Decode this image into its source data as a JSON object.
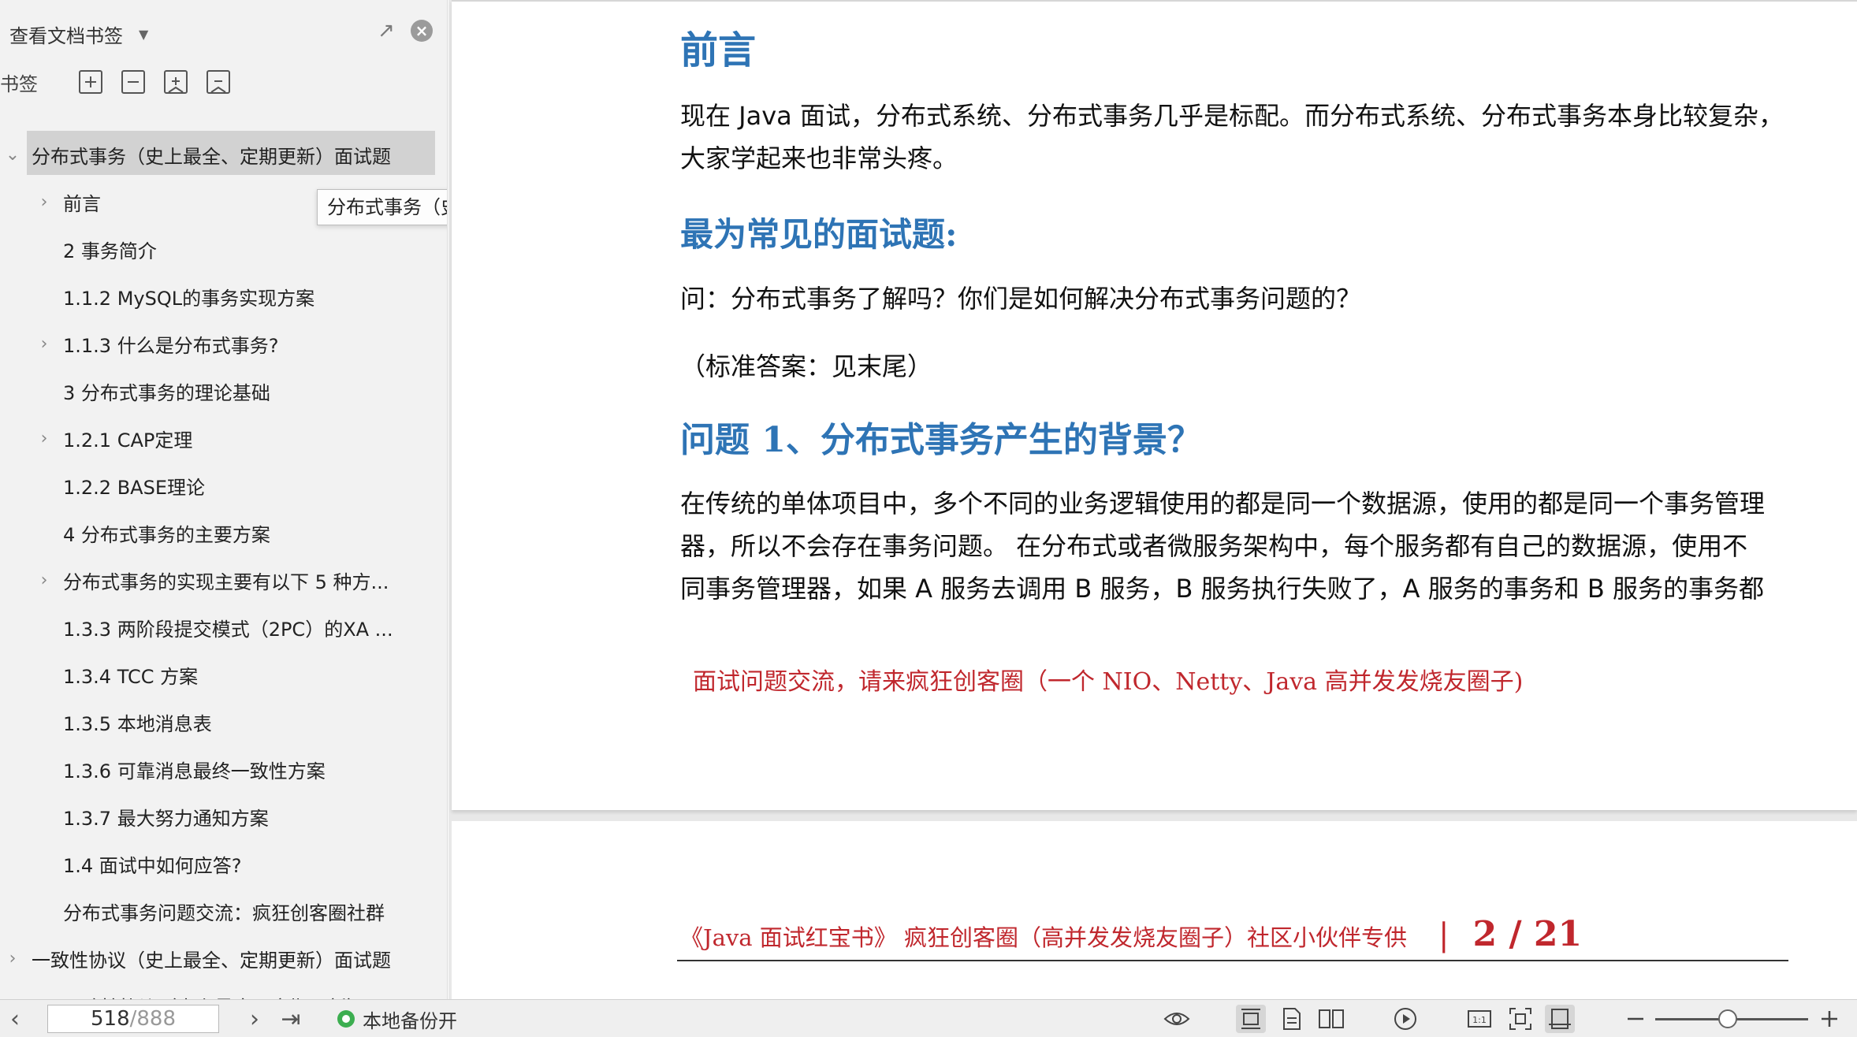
{
  "sidebar": {
    "header_title": "查看文档书签",
    "tools_label": "书签",
    "tooltip": "分布式事务（史上最全、定期更新）面试题",
    "items": [
      {
        "label": "分布式事务（史上最全、定期更新）面试题",
        "expanded": true,
        "selected": true
      },
      {
        "label": "前言",
        "has_children": true
      },
      {
        "label": "2 事务简介"
      },
      {
        "label": "1.1.2 MySQL的事务实现方案"
      },
      {
        "label": "1.1.3 什么是分布式事务?",
        "has_children": true
      },
      {
        "label": "3 分布式事务的理论基础"
      },
      {
        "label": "1.2.1 CAP定理",
        "has_children": true
      },
      {
        "label": "1.2.2 BASE理论"
      },
      {
        "label": "4 分布式事务的主要方案"
      },
      {
        "label": "分布式事务的实现主要有以下 5 种方...",
        "has_children": true
      },
      {
        "label": "1.3.3 两阶段提交模式（2PC）的XA ..."
      },
      {
        "label": "1.3.4 TCC 方案"
      },
      {
        "label": "1.3.5 本地消息表"
      },
      {
        "label": "1.3.6 可靠消息最终一致性方案"
      },
      {
        "label": "1.3.7 最大努力通知方案"
      },
      {
        "label": "1.4 面试中如何应答?"
      },
      {
        "label": "分布式事务问题交流：疯狂创客圈社群"
      },
      {
        "label": "一致性协议（史上最全、定期更新）面试题",
        "has_children": true
      },
      {
        "label": "一致性协议（史上最全、定期更新）"
      }
    ]
  },
  "document": {
    "h_preface": "前言",
    "preface_lines": [
      "现在 Java 面试，分布式系统、分布式事务几乎是标配。而分布式系统、分布式事务本身比较复杂，",
      "大家学起来也非常头疼。"
    ],
    "h_common": "最为常见的面试题:",
    "question": "问：分布式事务了解吗？你们是如何解决分布式事务问题的？",
    "answer": "（标准答案：见末尾）",
    "h_q1": "问题 1、分布式事务产生的背景？",
    "q1_lines": [
      "在传统的单体项目中，多个不同的业务逻辑使用的都是同一个数据源，使用的都是同一个事务管理",
      "器，所以不会存在事务问题。 在分布式或者微服务架构中，每个服务都有自己的数据源，使用不",
      "同事务管理器，如果 A 服务去调用 B 服务，B 服务执行失败了，A 服务的事务和 B 服务的事务都"
    ],
    "red_note": "面试问题交流，请来疯狂创客圈（一个 NIO、Netty、Java 高并发发烧友圈子)",
    "footer_text": "《Java 面试红宝书》 疯狂创客圈（高并发发烧友圈子）社区小伙伴专供",
    "footer_page": "2 / 21"
  },
  "statusbar": {
    "current_page": "518",
    "total_pages": "/888",
    "backup_label": "本地备份开"
  },
  "colors": {
    "heading_blue": "#2e74b5",
    "accent_red": "#c0272d",
    "sidebar_bg": "#f2f2f2",
    "selected_bg": "#d2d2d2"
  },
  "icons": [
    "chevron-left-icon",
    "chevron-right-icon",
    "last-page-icon",
    "eye-icon",
    "single-page-icon",
    "continuous-page-icon",
    "two-page-icon",
    "play-icon",
    "actual-size-icon",
    "fit-page-icon",
    "fit-width-icon",
    "zoom-out-icon",
    "zoom-in-icon",
    "unpin-icon",
    "close-icon",
    "expand-all-icon",
    "collapse-all-icon",
    "add-bookmark-icon",
    "bookmark-icon"
  ]
}
